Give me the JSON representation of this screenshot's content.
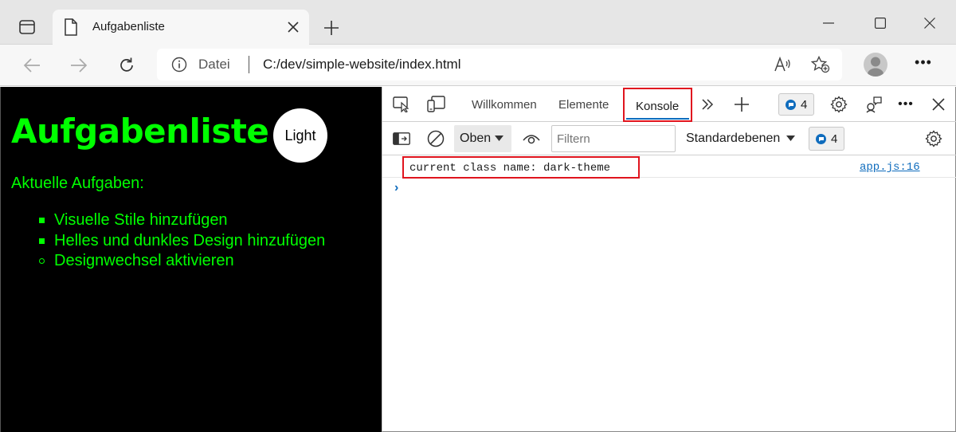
{
  "browser": {
    "tab_title": "Aufgabenliste",
    "address": {
      "scheme_label": "Datei",
      "url": "C:/dev/simple-website/index.html"
    }
  },
  "webpage": {
    "title": "Aufgabenliste",
    "theme_button": "Light",
    "tasks_heading": "Aktuelle Aufgaben:",
    "tasks": [
      {
        "label": "Visuelle Stile hinzufügen",
        "done": true
      },
      {
        "label": "Helles und dunkles Design hinzufügen",
        "done": true
      },
      {
        "label": "Designwechsel aktivieren",
        "done": false
      }
    ],
    "colors": {
      "background": "#000000",
      "text": "#00ff00"
    }
  },
  "devtools": {
    "tabs": [
      "Willkommen",
      "Elemente",
      "Konsole"
    ],
    "active_tab": "Konsole",
    "issues_count": "4",
    "context": "Oben",
    "filter_placeholder": "Filtern",
    "levels": "Standardebenen",
    "levels_count": "4",
    "messages": [
      {
        "text": "current class name: dark-theme",
        "source": "app.js:16"
      }
    ],
    "prompt": "›"
  }
}
